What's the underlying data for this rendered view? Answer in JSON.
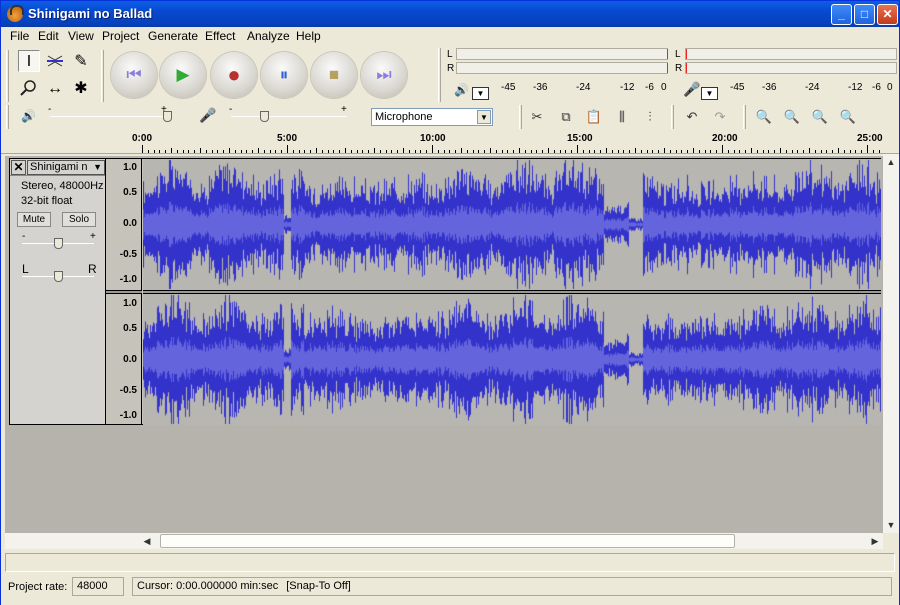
{
  "window": {
    "title": "Shinigami no Ballad",
    "controls": {
      "minimize": "_",
      "maximize": "□",
      "close": "✕"
    }
  },
  "menu": [
    "File",
    "Edit",
    "View",
    "Project",
    "Generate",
    "Effect",
    "Analyze",
    "Help"
  ],
  "tools": {
    "selection": "I",
    "envelope": "envelope",
    "draw": "✎",
    "zoom": "zoom",
    "timeshift": "↔",
    "multi": "✱"
  },
  "transport": {
    "skip_start": "⏮",
    "play": "▶",
    "record": "●",
    "pause": "⏸",
    "stop": "■",
    "skip_end": "⏭"
  },
  "meters": {
    "left": "L",
    "right": "R",
    "scale": [
      "-45",
      "-36",
      "-24",
      "-12",
      "-6",
      "0"
    ]
  },
  "mixer": {
    "input_select": "Microphone",
    "slider_minus": "-",
    "slider_plus": "+"
  },
  "ruler": {
    "labels": [
      "0:00",
      "5:00",
      "10:00",
      "15:00",
      "20:00",
      "25:00"
    ]
  },
  "track": {
    "name": "Shinigami n",
    "format": "Stereo, 48000Hz",
    "bits": "32-bit float",
    "mute": "Mute",
    "solo": "Solo",
    "gain_minus": "-",
    "gain_plus": "+",
    "pan_left": "L",
    "pan_right": "R",
    "close": "✕"
  },
  "vscale": [
    "1.0",
    "0.5",
    "0.0",
    "-0.5",
    "-1.0"
  ],
  "status": {
    "rate_label": "Project rate:",
    "rate_value": "48000",
    "cursor": "Cursor: 0:00.000000 min:sec",
    "snap": "[Snap-To Off]"
  },
  "colors": {
    "wave": "#3333cc",
    "wave_rms": "#6464dc",
    "titlebar": "#0a5fe6",
    "bg": "#ece9d8"
  }
}
